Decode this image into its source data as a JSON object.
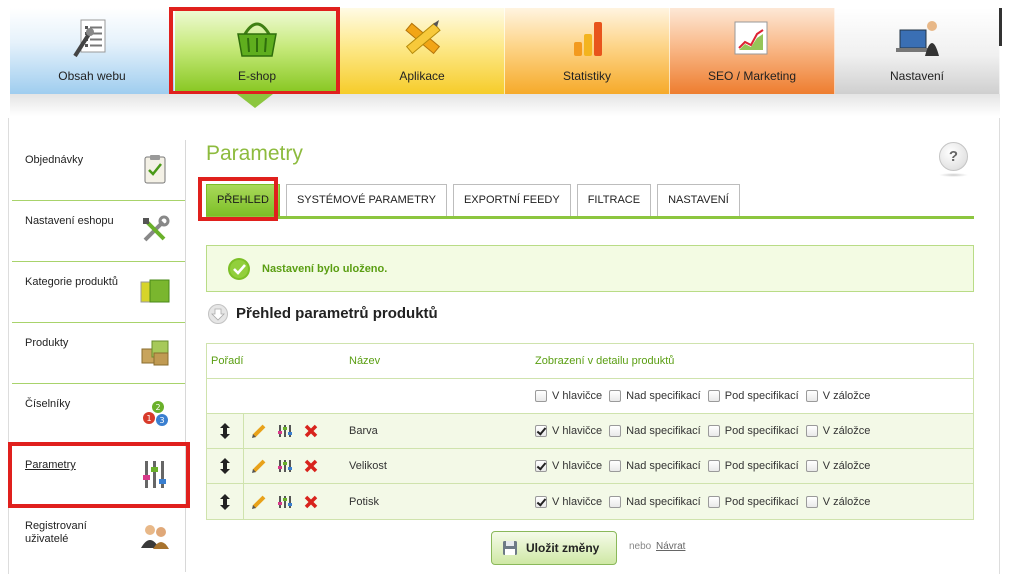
{
  "nav": {
    "tabs": [
      {
        "label": "Obsah webu",
        "icon": "document-list-icon"
      },
      {
        "label": "E-shop",
        "icon": "shopping-basket-icon"
      },
      {
        "label": "Aplikace",
        "icon": "pencil-ruler-icon"
      },
      {
        "label": "Statistiky",
        "icon": "bar-chart-icon"
      },
      {
        "label": "SEO / Marketing",
        "icon": "line-chart-icon"
      },
      {
        "label": "Nastavení",
        "icon": "user-laptop-icon"
      }
    ],
    "active": "E-shop"
  },
  "sidebar": {
    "items": [
      {
        "label": "Objednávky",
        "icon": "clipboard-check-icon"
      },
      {
        "label": "Nastavení eshopu",
        "icon": "tools-icon"
      },
      {
        "label": "Kategorie produktů",
        "icon": "folders-icon"
      },
      {
        "label": "Produkty",
        "icon": "boxes-icon"
      },
      {
        "label": "Číselníky",
        "icon": "numbered-balls-icon"
      },
      {
        "label": "Parametry",
        "icon": "sliders-icon"
      },
      {
        "label": "Registrovaní uživatelé",
        "icon": "users-icon"
      }
    ],
    "active": "Parametry"
  },
  "page": {
    "title": "Parametry",
    "help_label": "?"
  },
  "tabs": [
    {
      "label": "PŘEHLED",
      "active": true
    },
    {
      "label": "SYSTÉMOVÉ PARAMETRY",
      "active": false
    },
    {
      "label": "EXPORTNÍ FEEDY",
      "active": false
    },
    {
      "label": "FILTRACE",
      "active": false
    },
    {
      "label": "NASTAVENÍ",
      "active": false
    }
  ],
  "notice": {
    "text": "Nastavení bylo uloženo."
  },
  "section": {
    "title": "Přehled parametrů produktů"
  },
  "table": {
    "headers": {
      "order": "Pořadí",
      "name": "Název",
      "display": "Zobrazení v detailu produktů"
    },
    "display_options": [
      "V hlavičce",
      "Nad specifikací",
      "Pod specifikací",
      "V záložce"
    ],
    "filter_checked": [
      false,
      false,
      false,
      false
    ],
    "rows": [
      {
        "name": "Barva",
        "checked": [
          true,
          false,
          false,
          false
        ]
      },
      {
        "name": "Velikost",
        "checked": [
          true,
          false,
          false,
          false
        ]
      },
      {
        "name": "Potisk",
        "checked": [
          true,
          false,
          false,
          false
        ]
      }
    ]
  },
  "footer": {
    "save_label": "Uložit změny",
    "or_text": "nebo",
    "back_label": "Návrat"
  },
  "colors": {
    "accent_green": "#8cc63f",
    "title_green": "#8dbb3e",
    "highlight_red": "#e0201d"
  }
}
